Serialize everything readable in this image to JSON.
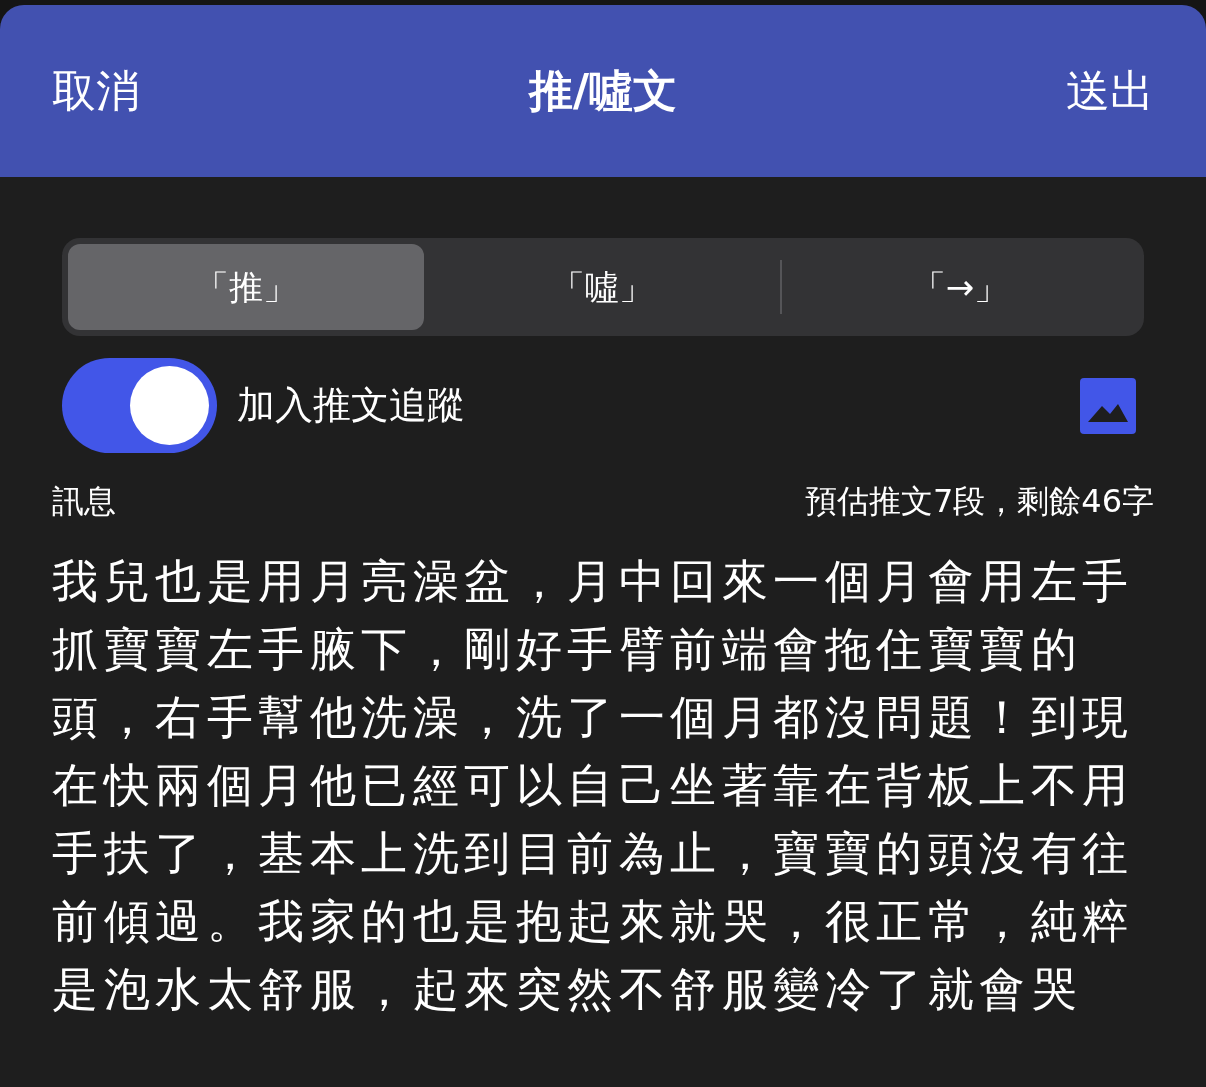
{
  "header": {
    "cancel": "取消",
    "title": "推/噓文",
    "send": "送出"
  },
  "segments": [
    {
      "label": "「推」",
      "selected": true
    },
    {
      "label": "「噓」",
      "selected": false
    },
    {
      "label": "「→」",
      "selected": false
    }
  ],
  "follow": {
    "label": "加入推文追蹤",
    "on": true
  },
  "message": {
    "label": "訊息",
    "estimate": "預估推文7段，剩餘46字",
    "text": "我兒也是用月亮澡盆，月中回來一個月會用左手抓寶寶左手腋下，剛好手臂前端會拖住寶寶的頭，右手幫他洗澡，洗了一個月都沒問題！到現在快兩個月他已經可以自己坐著靠在背板上不用手扶了，基本上洗到目前為止，寶寶的頭沒有往前傾過。我家的也是抱起來就哭，很正常，純粹是泡水太舒服，起來突然不舒服變冷了就會哭"
  }
}
